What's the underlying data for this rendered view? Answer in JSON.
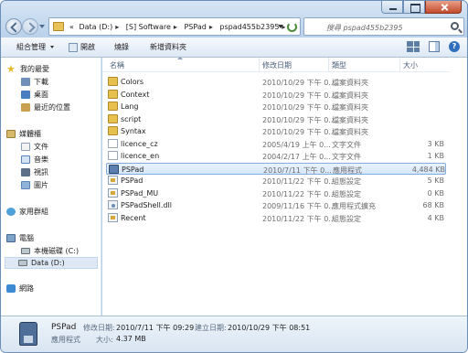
{
  "address": {
    "crumbs": [
      "«",
      "Data (D:)",
      "[S] Software",
      "PSPad",
      "pspad455b2395"
    ]
  },
  "search": {
    "placeholder": "搜尋 pspad455b2395"
  },
  "toolbar": {
    "organize": "組合管理",
    "open": "開啟",
    "burn": "燒錄",
    "new_folder": "新增資料夾"
  },
  "sidebar": {
    "favorites": {
      "label": "我的最愛",
      "items": [
        "下載",
        "桌面",
        "最近的位置"
      ]
    },
    "libraries": {
      "label": "媒體櫃",
      "items": [
        "文件",
        "音樂",
        "視訊",
        "圖片"
      ]
    },
    "homegroup": "家用群組",
    "computer": {
      "label": "電腦",
      "items": [
        "本機磁碟 (C:)",
        "Data (D:)"
      ]
    },
    "network": "網路"
  },
  "columns": {
    "name": "名稱",
    "modified": "修改日期",
    "type": "類型",
    "size": "大小"
  },
  "files": [
    {
      "name": "Colors",
      "modified": "2010/10/29 下午 0...",
      "type": "檔案資料夾",
      "size": "",
      "kind": "folder"
    },
    {
      "name": "Context",
      "modified": "2010/10/29 下午 0...",
      "type": "檔案資料夾",
      "size": "",
      "kind": "folder"
    },
    {
      "name": "Lang",
      "modified": "2010/10/29 下午 0...",
      "type": "檔案資料夾",
      "size": "",
      "kind": "folder"
    },
    {
      "name": "script",
      "modified": "2010/10/29 下午 0...",
      "type": "檔案資料夾",
      "size": "",
      "kind": "folder"
    },
    {
      "name": "Syntax",
      "modified": "2010/10/29 下午 0...",
      "type": "檔案資料夾",
      "size": "",
      "kind": "folder"
    },
    {
      "name": "licence_cz",
      "modified": "2005/4/19 上午 0...",
      "type": "文字文件",
      "size": "3 KB",
      "kind": "text"
    },
    {
      "name": "licence_en",
      "modified": "2004/2/17 上午 0...",
      "type": "文字文件",
      "size": "1 KB",
      "kind": "text"
    },
    {
      "name": "PSPad",
      "modified": "2010/7/11 下午 0...",
      "type": "應用程式",
      "size": "4,484 KB",
      "kind": "app"
    },
    {
      "name": "PSPad",
      "modified": "2010/11/22 下午 0...",
      "type": "組態設定",
      "size": "5 KB",
      "kind": "ini"
    },
    {
      "name": "PSPad_MU",
      "modified": "2010/11/22 下午 0...",
      "type": "組態設定",
      "size": "0 KB",
      "kind": "ini"
    },
    {
      "name": "PSPadShell.dll",
      "modified": "2009/11/16 下午 0...",
      "type": "應用程式擴充",
      "size": "68 KB",
      "kind": "dll"
    },
    {
      "name": "Recent",
      "modified": "2010/11/22 下午 0...",
      "type": "組態設定",
      "size": "4 KB",
      "kind": "ini"
    }
  ],
  "selected_index": 7,
  "details": {
    "name": "PSPad",
    "modified_label": "修改日期:",
    "modified_value": "2010/7/11 下午 09:29",
    "created_label": "建立日期:",
    "created_value": "2010/10/29 下午 08:51",
    "type": "應用程式",
    "size_label": "大小:",
    "size_value": "4.37 MB"
  }
}
